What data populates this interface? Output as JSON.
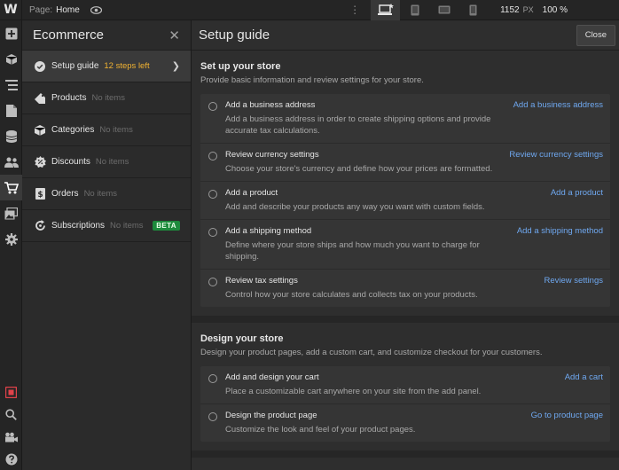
{
  "topbar": {
    "logo": "W",
    "page_label": "Page:",
    "page_name": "Home",
    "viewport_size": "1152",
    "viewport_unit": "PX",
    "zoom": "100 %"
  },
  "panel": {
    "title": "Ecommerce",
    "items": [
      {
        "label": "Setup guide",
        "status": "12 steps left"
      },
      {
        "label": "Products",
        "count": "No items"
      },
      {
        "label": "Categories",
        "count": "No items"
      },
      {
        "label": "Discounts",
        "count": "No items"
      },
      {
        "label": "Orders",
        "count": "No items"
      },
      {
        "label": "Subscriptions",
        "count": "No items",
        "badge": "BETA"
      }
    ]
  },
  "main": {
    "title": "Setup guide",
    "close_label": "Close",
    "sections": [
      {
        "title": "Set up your store",
        "subtitle": "Provide basic information and review settings for your store.",
        "tasks": [
          {
            "title": "Add a business address",
            "desc": "Add a business address in order to create shipping options and provide accurate tax calculations.",
            "link": "Add a business address"
          },
          {
            "title": "Review currency settings",
            "desc": "Choose your store's currency and define how your prices are formatted.",
            "link": "Review currency settings"
          },
          {
            "title": "Add a product",
            "desc": "Add and describe your products any way you want with custom fields.",
            "link": "Add a product"
          },
          {
            "title": "Add a shipping method",
            "desc": "Define where your store ships and how much you want to charge for shipping.",
            "link": "Add a shipping method"
          },
          {
            "title": "Review tax settings",
            "desc": "Control how your store calculates and collects tax on your products.",
            "link": "Review settings"
          }
        ]
      },
      {
        "title": "Design your store",
        "subtitle": "Design your product pages, add a custom cart, and customize checkout for your customers.",
        "tasks": [
          {
            "title": "Add and design your cart",
            "desc": "Place a customizable cart anywhere on your site from the add panel.",
            "link": "Add a cart"
          },
          {
            "title": "Design the product page",
            "desc": "Customize the look and feel of your product pages.",
            "link": "Go to product page"
          }
        ]
      }
    ]
  },
  "colors": {
    "accent_link": "#6fa8f0",
    "steps_left": "#f0b232",
    "beta_badge": "#1d8a3c",
    "rail_red": "#e0424a"
  }
}
